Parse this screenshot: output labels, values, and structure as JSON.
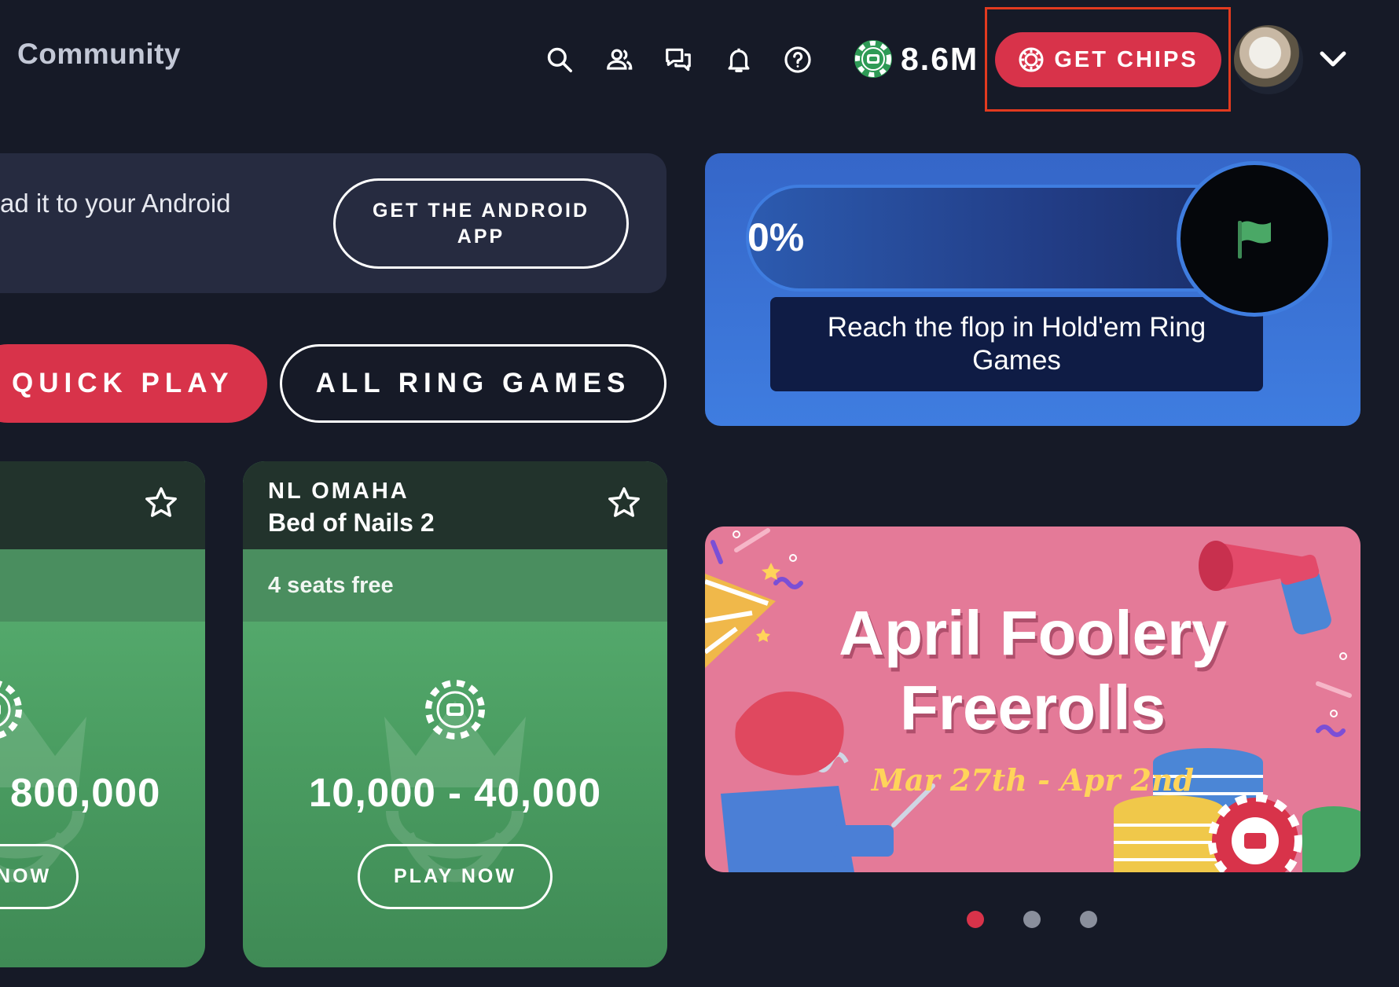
{
  "nav": {
    "community_label": "Community",
    "icons": [
      "search-icon",
      "friends-icon",
      "chat-icon",
      "bell-icon",
      "help-icon"
    ],
    "balance": "8.6M",
    "get_chips_label": "GET CHIPS",
    "colors": {
      "accent_red": "#d8334a",
      "highlight_outline": "#e23a1f",
      "chip_green": "#2e9a55"
    }
  },
  "android_banner": {
    "text": "ad it to your Android",
    "button_label": "GET THE ANDROID APP"
  },
  "play_buttons": {
    "quick_play": "QUICK PLAY",
    "all_ring_games": "ALL RING GAMES"
  },
  "game_cards": [
    {
      "type": "",
      "name": "",
      "seats": "",
      "stakes": "800,000",
      "play_label": "NOW"
    },
    {
      "type": "NL OMAHA",
      "name": "Bed of Nails 2",
      "seats": "4 seats free",
      "stakes": "10,000 - 40,000",
      "play_label": "PLAY NOW"
    }
  ],
  "mission": {
    "progress_text": "0%",
    "progress_value": 0,
    "description": "Reach the flop in Hold'em Ring Games",
    "icon": "flag-icon"
  },
  "promo": {
    "title_line1": "April Foolery",
    "title_line2": "Freerolls",
    "dates": "Mar 27th - Apr 2nd"
  },
  "carousel": {
    "dot_count": 3,
    "active_index": 0,
    "colors": {
      "active": "#d8334a",
      "inactive": "#8a8f9c"
    }
  }
}
